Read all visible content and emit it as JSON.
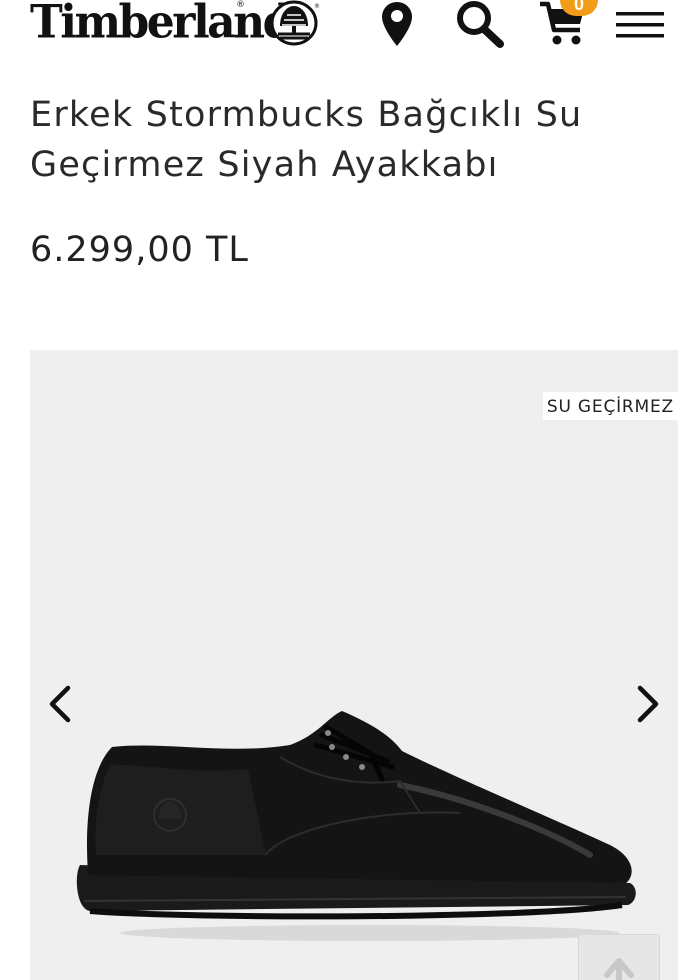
{
  "header": {
    "logo_text": "Timberland",
    "cart_count": "0",
    "icons": [
      "location-pin-icon",
      "search-icon",
      "cart-icon",
      "hamburger-menu-icon"
    ]
  },
  "product": {
    "title": "Erkek Stormbucks Bağcıklı Su Geçirmez Siyah Ayakkabı",
    "price": "6.299,00 TL",
    "badge": "SU GEÇİRMEZ"
  },
  "colors": {
    "badge_accent": "#f39c18",
    "gallery_bg": "#efefef",
    "text": "#222222"
  }
}
